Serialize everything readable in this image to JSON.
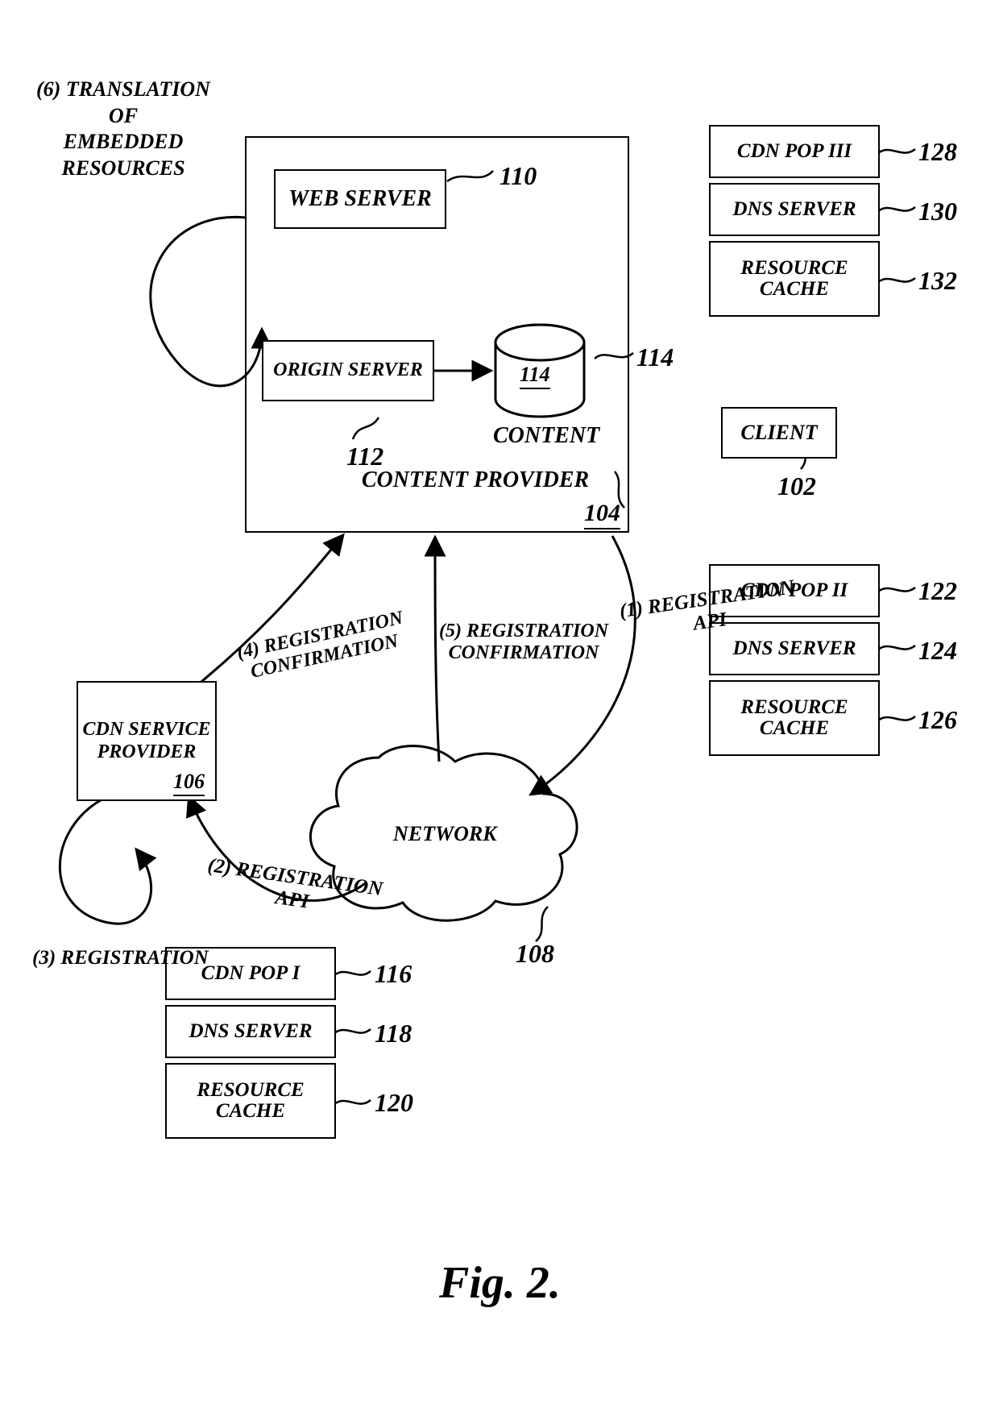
{
  "figure_caption": "Fig. 2.",
  "content_provider": {
    "label": "CONTENT PROVIDER",
    "ref": "104",
    "web_server": {
      "label": "WEB SERVER",
      "ref": "110"
    },
    "origin_server": {
      "label": "ORIGIN SERVER",
      "ref": "112"
    },
    "content_store": {
      "label": "CONTENT",
      "ref": "114"
    }
  },
  "cdn_service_provider": {
    "label": "CDN SERVICE\nPROVIDER",
    "ref": "106"
  },
  "network": {
    "label": "NETWORK",
    "ref": "108"
  },
  "client": {
    "label": "CLIENT",
    "ref": "102"
  },
  "pops": {
    "pop1": {
      "header": "CDN POP I",
      "dns": "DNS SERVER",
      "cache": "RESOURCE\nCACHE",
      "header_ref": "116",
      "dns_ref": "118",
      "cache_ref": "120"
    },
    "pop2": {
      "header": "CDN POP II",
      "dns": "DNS SERVER",
      "cache": "RESOURCE\nCACHE",
      "header_ref": "122",
      "dns_ref": "124",
      "cache_ref": "126"
    },
    "pop3": {
      "header": "CDN POP III",
      "dns": "DNS SERVER",
      "cache": "RESOURCE\nCACHE",
      "header_ref": "128",
      "dns_ref": "130",
      "cache_ref": "132"
    }
  },
  "flows": {
    "f1": "(1) REGISTRATION\nAPI",
    "f2": "(2) REGISTRATION\nAPI",
    "f3": "(3) REGISTRATION",
    "f4": "(4) REGISTRATION\nCONFIRMATION",
    "f5": "(5) REGISTRATION\nCONFIRMATION",
    "f6": "(6) TRANSLATION\nOF\nEMBEDDED\nRESOURCES"
  }
}
